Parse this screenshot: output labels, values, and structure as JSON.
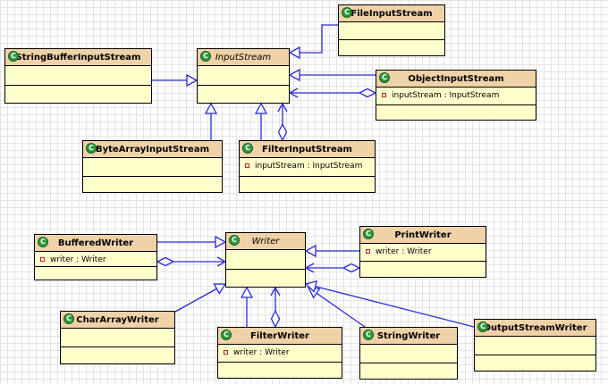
{
  "classes": {
    "file_input_stream": {
      "name": "FileInputStream"
    },
    "string_buffer_input_stream": {
      "name": "StringBufferInputStream"
    },
    "input_stream": {
      "name": "InputStream",
      "abstract": true
    },
    "object_input_stream": {
      "name": "ObjectInputStream",
      "attr": "inputStream : InputStream"
    },
    "byte_array_input_stream": {
      "name": "ByteArrayInputStream"
    },
    "filter_input_stream": {
      "name": "FilterInputStream",
      "attr": "inputStream : InputStream"
    },
    "buffered_writer": {
      "name": "BufferedWriter",
      "attr": "writer : Writer"
    },
    "writer": {
      "name": "Writer",
      "abstract": true
    },
    "print_writer": {
      "name": "PrintWriter",
      "attr": "writer : Writer"
    },
    "char_array_writer": {
      "name": "CharArrayWriter"
    },
    "filter_writer": {
      "name": "FilterWriter",
      "attr": "writer : Writer"
    },
    "string_writer": {
      "name": "StringWriter"
    },
    "output_stream_writer": {
      "name": "OutputStreamWriter"
    }
  },
  "class_icon_letter": "C",
  "colors": {
    "header": "#f0d2a8",
    "body": "#ffffcc",
    "edge": "#2a2ad8",
    "icon": "#2e9a3c"
  }
}
